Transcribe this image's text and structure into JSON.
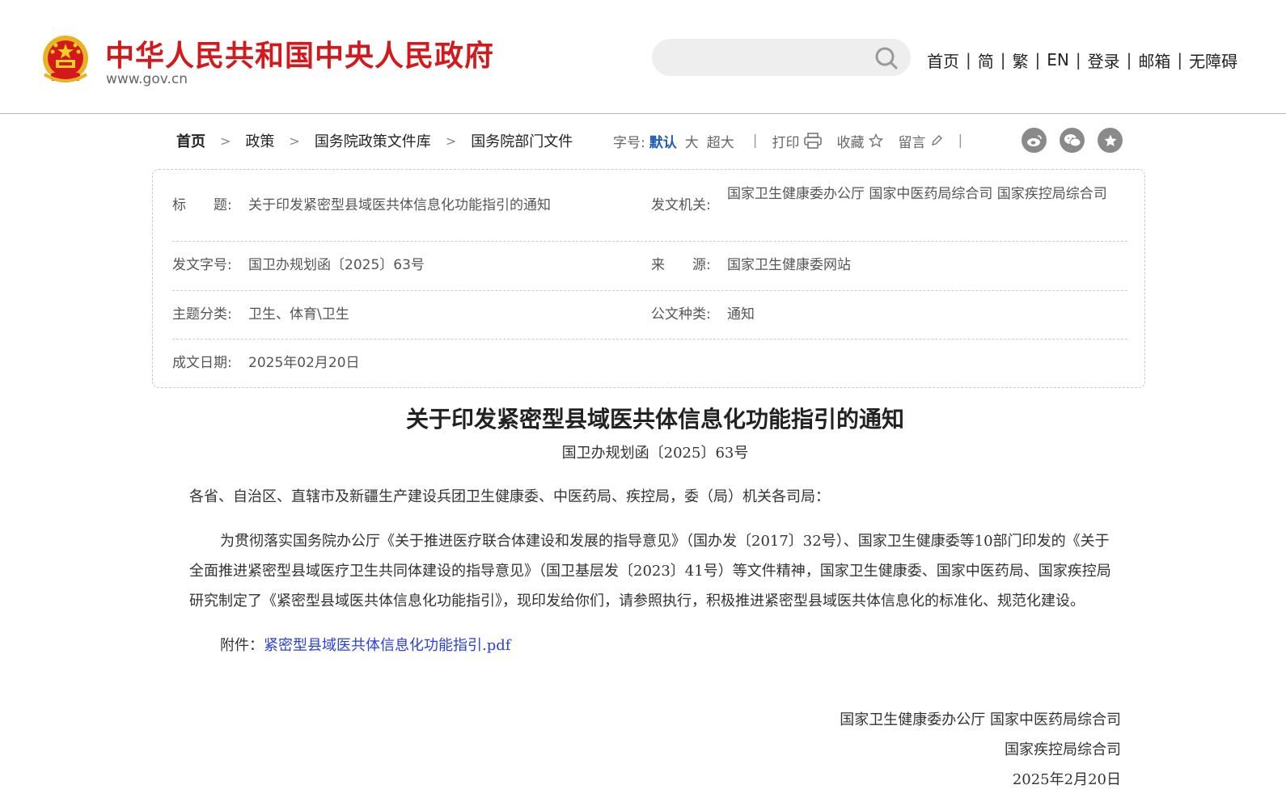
{
  "header": {
    "site_title": "中华人民共和国中央人民政府",
    "site_url": "www.gov.cn",
    "search": {
      "value": "",
      "placeholder": ""
    },
    "nav": [
      "首页",
      "简",
      "繁",
      "EN",
      "登录",
      "邮箱",
      "无障碍"
    ],
    "accent_color": "#d4191d"
  },
  "breadcrumb": [
    "首页",
    "政策",
    "国务院政策文件库",
    "国务院部门文件"
  ],
  "toolbar": {
    "font_size_label": "字号:",
    "font_sizes": [
      "默认",
      "大",
      "超大"
    ],
    "active_font_size": "默认",
    "print": "打印",
    "favorite": "收藏",
    "comment": "留言",
    "share_icons": [
      "weibo-icon",
      "wechat-icon",
      "star-icon"
    ]
  },
  "info": {
    "title_label": "标　　题:",
    "title_value": "关于印发紧密型县域医共体信息化功能指引的通知",
    "issuer_label": "发文机关:",
    "issuer_value": "国家卫生健康委办公厅  国家中医药局综合司  国家疾控局综合司",
    "docno_label": "发文字号:",
    "docno_value": "国卫办规划函〔2025〕63号",
    "source_label": "来　　源:",
    "source_value": "国家卫生健康委网站",
    "topic_label": "主题分类:",
    "topic_value": "卫生、体育\\卫生",
    "type_label": "公文种类:",
    "type_value": "通知",
    "date_label": "成文日期:",
    "date_value": "2025年02月20日"
  },
  "article": {
    "title": "关于印发紧密型县域医共体信息化功能指引的通知",
    "docno": "国卫办规划函〔2025〕63号",
    "salutation": "各省、自治区、直辖市及新疆生产建设兵团卫生健康委、中医药局、疾控局，委（局）机关各司局：",
    "paragraph": "为贯彻落实国务院办公厅《关于推进医疗联合体建设和发展的指导意见》（国办发〔2017〕32号）、国家卫生健康委等10部门印发的《关于全面推进紧密型县域医疗卫生共同体建设的指导意见》（国卫基层发〔2023〕41号）等文件精神，国家卫生健康委、国家中医药局、国家疾控局研究制定了《紧密型县域医共体信息化功能指引》，现印发给你们，请参照执行，积极推进紧密型县域医共体信息化的标准化、规范化建设。",
    "attachment_label": "附件：",
    "attachment_link": "紧密型县域医共体信息化功能指引.pdf",
    "signature": [
      "国家卫生健康委办公厅  国家中医药局综合司",
      "国家疾控局综合司",
      "2025年2月20日"
    ]
  }
}
